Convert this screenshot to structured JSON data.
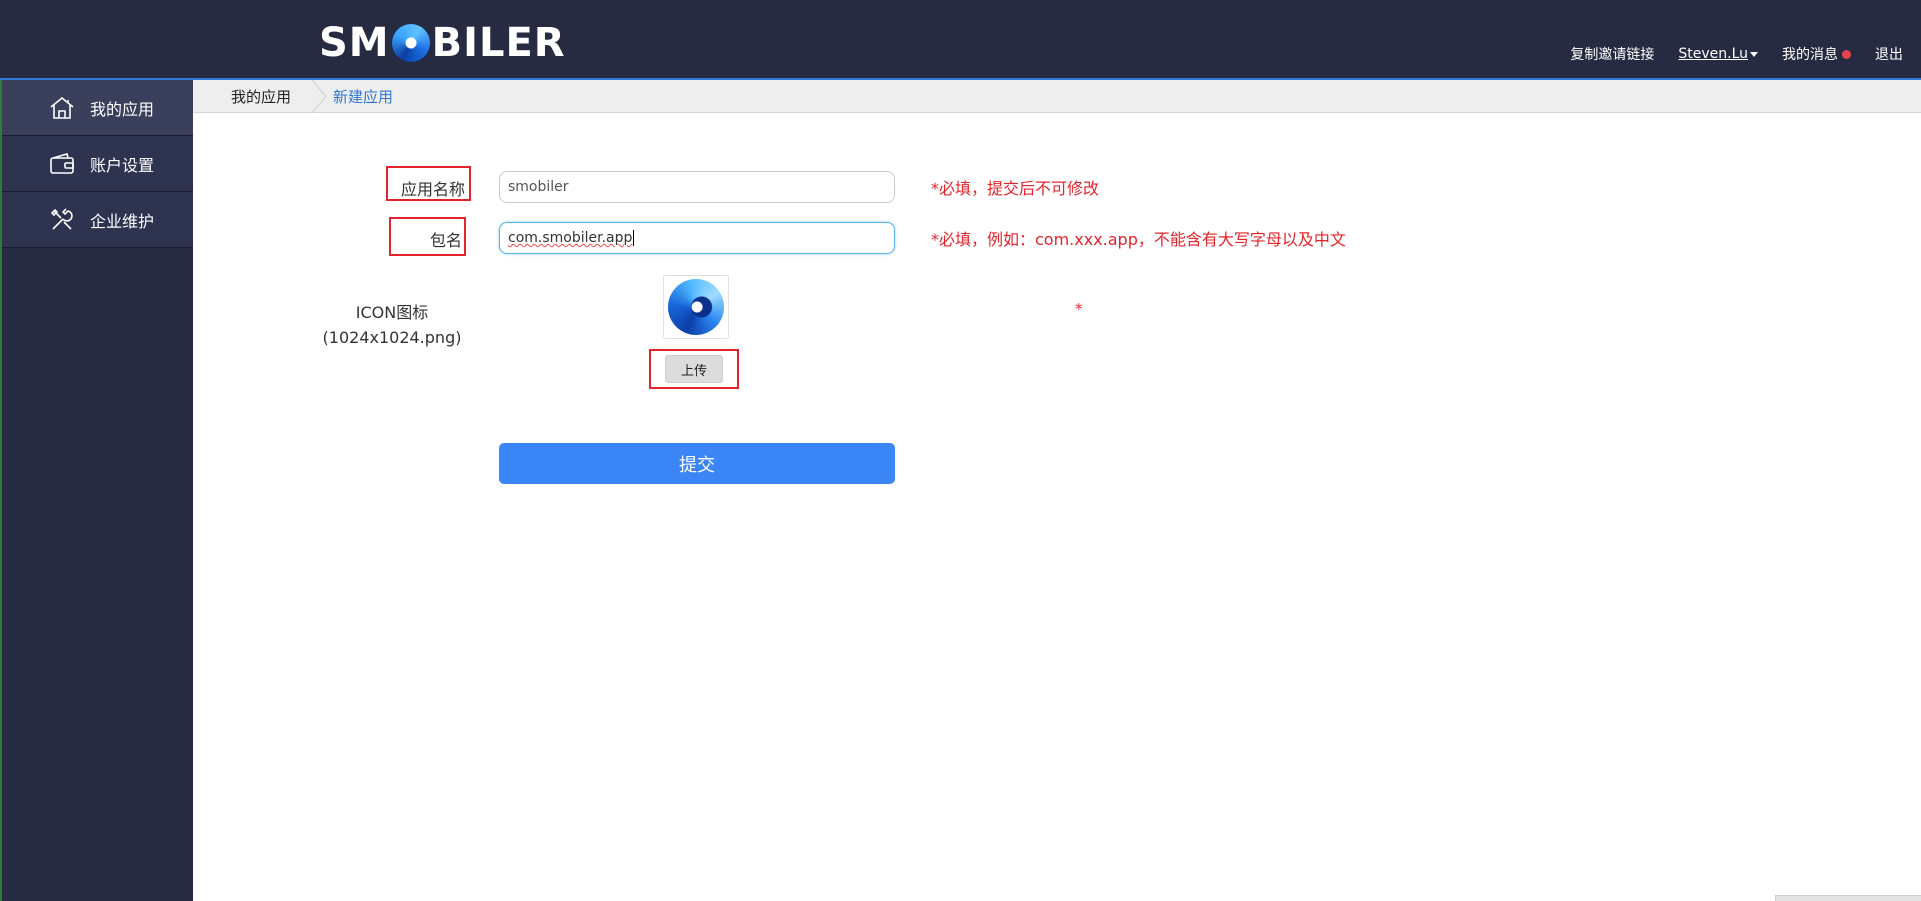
{
  "header": {
    "logo_left": "SM",
    "logo_right": "BILER",
    "copy_invite_link": "复制邀请链接",
    "user_name": "Steven.Lu",
    "my_messages": "我的消息",
    "logout": "退出",
    "status_dot_color": "#e8434a"
  },
  "sidebar": {
    "items": [
      {
        "label": "我的应用",
        "icon": "home-icon"
      },
      {
        "label": "账户设置",
        "icon": "wallet-icon"
      },
      {
        "label": "企业维护",
        "icon": "tools-icon"
      }
    ]
  },
  "breadcrumb": {
    "home": "我的应用",
    "current": "新建应用"
  },
  "form": {
    "app_name_label": "应用名称",
    "app_name_value": "smobiler",
    "app_name_hint": "*必填，提交后不可修改",
    "package_label": "包名",
    "package_value": "com.smobiler.app",
    "package_hint": "*必填，例如：com.xxx.app，不能含有大写字母以及中文",
    "icon_label_line1": "ICON图标",
    "icon_label_line2": "(1024x1024.png)",
    "icon_hint": "*",
    "upload_label": "上传",
    "submit_label": "提交"
  },
  "colors": {
    "header_bg": "#272b42",
    "accent_blue": "#3b86f7",
    "required_red": "#e3242b"
  }
}
